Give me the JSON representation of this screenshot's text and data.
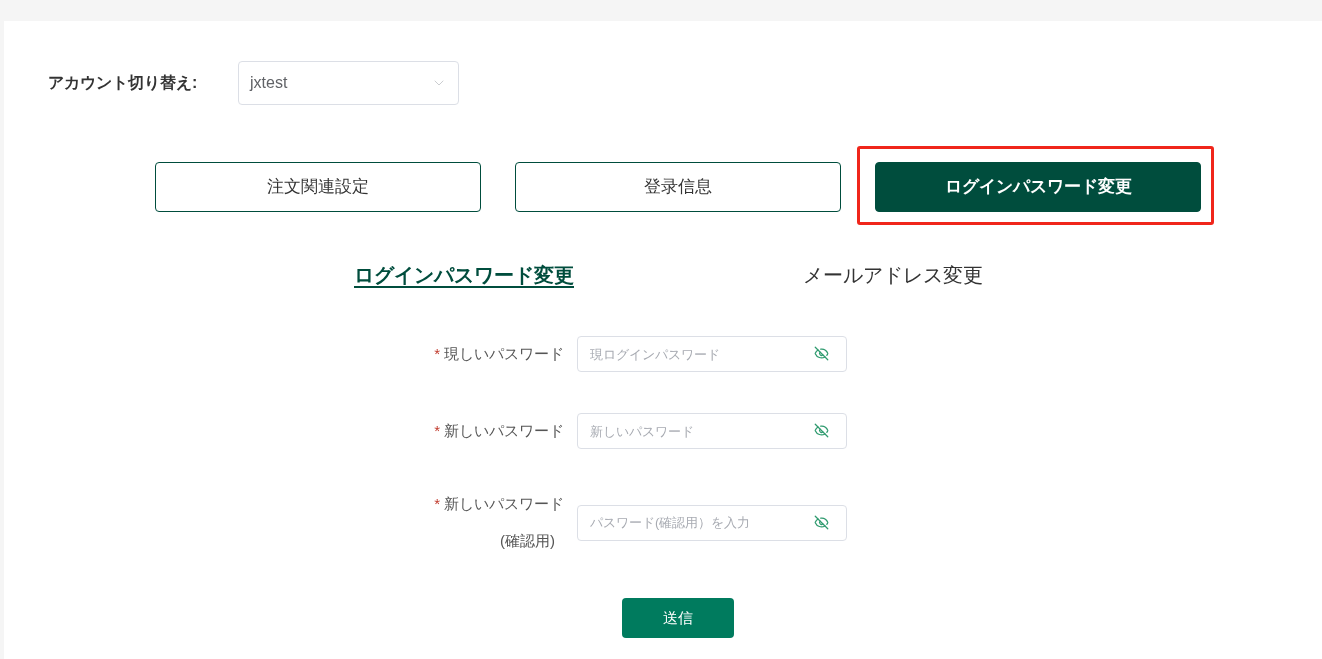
{
  "account_switch": {
    "label": "アカウント切り替え:",
    "value": "jxtest"
  },
  "buttons": [
    {
      "label": "注文関連設定",
      "selected": false,
      "highlighted": false
    },
    {
      "label": "登录信息",
      "selected": false,
      "highlighted": false
    },
    {
      "label": "ログインパスワード変更",
      "selected": true,
      "highlighted": true
    }
  ],
  "tabs": [
    {
      "label": "ログインパスワード変更",
      "selected": true
    },
    {
      "label": "メールアドレス変更",
      "selected": false
    }
  ],
  "fields": [
    {
      "required_mark": "*",
      "label": "現しいパスワード",
      "placeholder": "現ログインパスワード"
    },
    {
      "required_mark": "*",
      "label": "新しいパスワード",
      "placeholder": "新しいパスワード"
    },
    {
      "required_mark": "*",
      "label": "新しいパスワード",
      "note": "(確認用)",
      "placeholder": "パスワード(確認用）を入力"
    }
  ],
  "submit": "送信"
}
